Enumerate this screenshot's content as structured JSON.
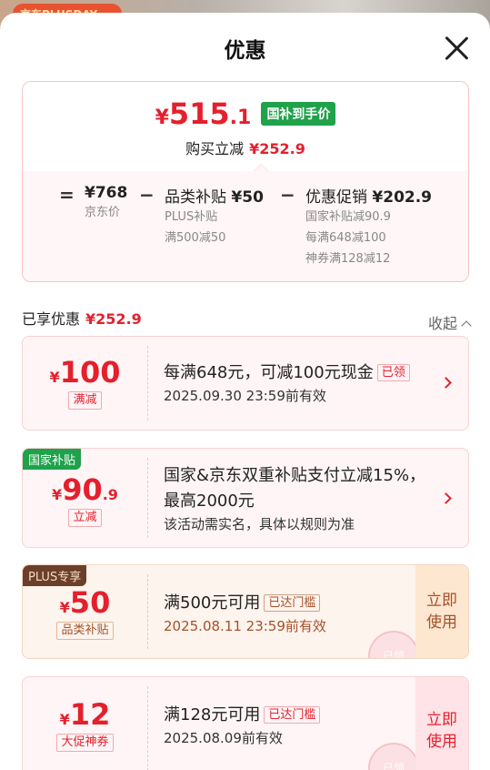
{
  "background": {
    "banner_text": "京东PLUSDAY"
  },
  "header": {
    "title": "优惠",
    "close_label": "关闭"
  },
  "summary": {
    "currency": "¥",
    "final_price_int": "515",
    "final_price_dec": ".1",
    "gov_tag": "国补到手价",
    "reduce_label": "购买立减",
    "reduce_amount": "¥252.9",
    "equals": "=",
    "minus": "−",
    "jd_price": {
      "value": "¥768",
      "label": "京东价"
    },
    "category_subsidy": {
      "title": "品类补贴",
      "value": "¥50",
      "lines": [
        "PLUS补贴",
        "满500减50"
      ]
    },
    "promo": {
      "title": "优惠促销",
      "value": "¥202.9",
      "lines": [
        "国家补贴减90.9",
        "每满648减100",
        "神券满128减12"
      ]
    }
  },
  "enjoyed": {
    "label": "已享优惠",
    "amount": "¥252.9"
  },
  "collapse_label": "收起",
  "coupons": [
    {
      "currency": "¥",
      "amount_int": "100",
      "amount_dec": "",
      "label": "满减",
      "title": "每满648元，可减100元现金",
      "title_tag": "已领",
      "subtitle": "2025.09.30 23:59前有效"
    },
    {
      "corner_tag": "国家补贴",
      "currency": "¥",
      "amount_int": "90",
      "amount_dec": ".9",
      "label": "立减",
      "title": "国家&京东双重补贴支付立减15%，最高2000元",
      "subtitle": "该活动需实名，具体以规则为准"
    },
    {
      "corner_tag": "PLUS专享",
      "currency": "¥",
      "amount_int": "50",
      "amount_dec": "",
      "label": "品类补贴",
      "title": "满500元可用",
      "title_tag": "已达门槛",
      "subtitle": "2025.08.11 23:59前有效",
      "action": [
        "立即",
        "使用"
      ],
      "stamp": "已领"
    },
    {
      "currency": "¥",
      "amount_int": "12",
      "amount_dec": "",
      "label": "大促神券",
      "title": "满128元可用",
      "title_tag": "已达门槛",
      "subtitle": "2025.08.09前有效",
      "action": [
        "立即",
        "使用"
      ],
      "stamp": "已领"
    }
  ],
  "colors": {
    "accent": "#e4202d",
    "gov_green": "#1fa24a",
    "plus_brown": "#6b3f2a"
  }
}
